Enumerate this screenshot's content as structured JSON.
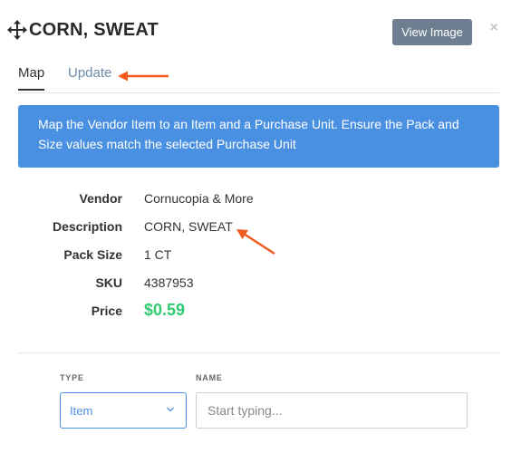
{
  "header": {
    "title": "CORN, SWEAT",
    "view_image_label": "View Image",
    "close_label": "×"
  },
  "tabs": [
    {
      "label": "Map",
      "active": true
    },
    {
      "label": "Update",
      "active": false
    }
  ],
  "banner": {
    "text": "Map the Vendor Item to an Item and a Purchase Unit. Ensure the Pack and Size values match the selected Purchase Unit",
    "color": "#4a90e2"
  },
  "details": {
    "vendor": {
      "label": "Vendor",
      "value": "Cornucopia & More"
    },
    "description": {
      "label": "Description",
      "value": "CORN, SWEAT"
    },
    "pack_size": {
      "label": "Pack Size",
      "value": "1 CT"
    },
    "sku": {
      "label": "SKU",
      "value": "4387953"
    },
    "price": {
      "label": "Price",
      "value": "$0.59",
      "color": "#2ecc71"
    }
  },
  "form": {
    "type_label": "TYPE",
    "type_value": "Item",
    "name_label": "NAME",
    "name_placeholder": "Start typing..."
  },
  "annotation_color": "#f05a1e"
}
